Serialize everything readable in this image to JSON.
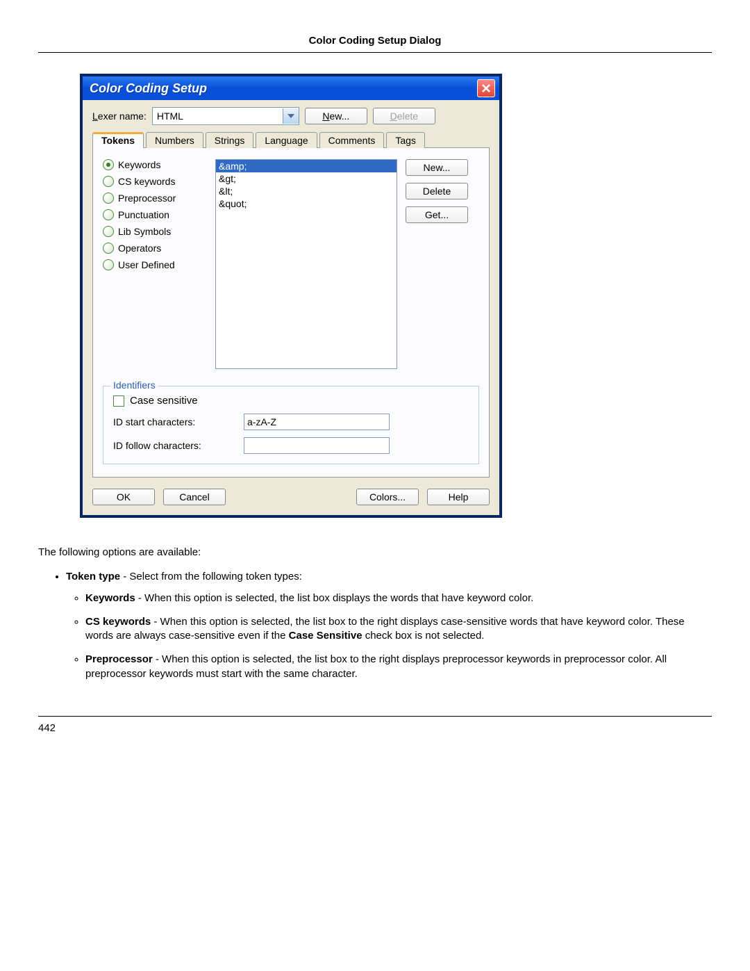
{
  "page_heading": "Color Coding Setup Dialog",
  "page_number": "442",
  "dialog": {
    "title": "Color Coding Setup",
    "lexer_label": "Lexer name:",
    "lexer_value": "HTML",
    "top_new_btn": "New...",
    "top_delete_btn": "Delete",
    "tabs": [
      "Tokens",
      "Numbers",
      "Strings",
      "Language",
      "Comments",
      "Tags"
    ],
    "active_tab": 0,
    "radios": [
      "Keywords",
      "CS keywords",
      "Preprocessor",
      "Punctuation",
      "Lib Symbols",
      "Operators",
      "User Defined"
    ],
    "selected_radio": 0,
    "tokens": [
      "&amp;",
      "&gt;",
      "&lt;",
      "&quot;"
    ],
    "selected_token": 0,
    "side_new_btn": "New...",
    "side_delete_btn": "Delete",
    "side_get_btn": "Get...",
    "identifiers_legend": "Identifiers",
    "case_sensitive_label": "Case sensitive",
    "id_start_label": "ID start characters:",
    "id_start_value": "a-zA-Z",
    "id_follow_label": "ID follow characters:",
    "id_follow_value": "",
    "ok_btn": "OK",
    "cancel_btn": "Cancel",
    "colors_btn": "Colors...",
    "help_btn": "Help"
  },
  "doc": {
    "intro": "The following options are available:",
    "token_type_prefix": "Token type",
    "token_type_rest": " - Select from the following token types:",
    "kw_prefix": "Keywords",
    "kw_rest": " - When this option is selected, the list box displays the words that have keyword color.",
    "cskw_prefix": "CS keywords",
    "cskw_rest_1": " - When this option is selected, the list box to the right displays case-sensitive words that have keyword color. These words are always case-sensitive even if the ",
    "cskw_bold": "Case Sensitive",
    "cskw_rest_2": " check box is not selected.",
    "pp_prefix": "Preprocessor",
    "pp_rest": " - When this option is selected, the list box to the right displays preprocessor keywords in preprocessor color. All preprocessor keywords must start with the same character."
  }
}
